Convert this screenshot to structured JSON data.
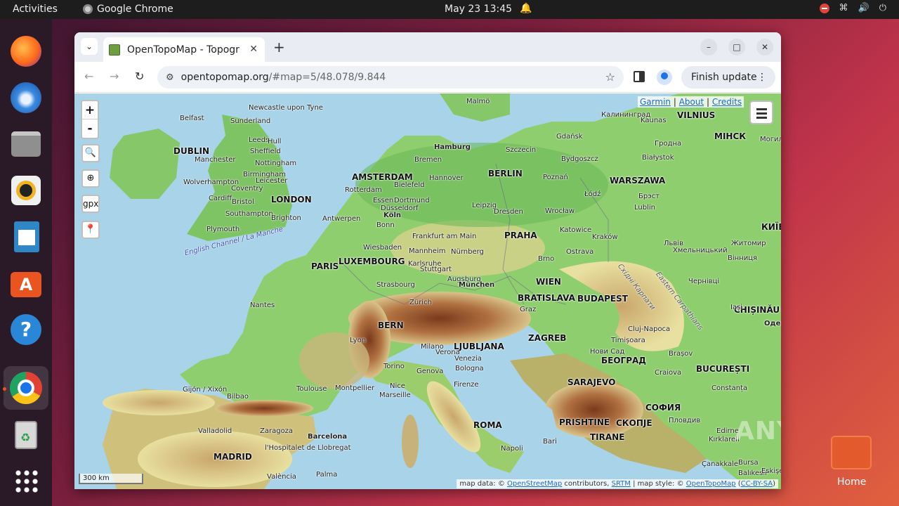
{
  "topbar": {
    "activities": "Activities",
    "app_name": "Google Chrome",
    "clock": "May 23  13:45"
  },
  "dock": {
    "items": [
      "Firefox",
      "Thunderbird",
      "Files",
      "Rhythmbox",
      "LibreOffice Writer",
      "Ubuntu Software",
      "Help",
      "Google Chrome",
      "Trash",
      "Show Applications"
    ]
  },
  "chrome": {
    "tab_title": "OpenTopoMap - Topogr",
    "address_host": "opentopomap.org",
    "address_path": "/#map=5/48.078/9.844",
    "update_label": "Finish update"
  },
  "map": {
    "zoom_in": "+",
    "zoom_out": "-",
    "gpx": "gpx",
    "attrib_top": [
      "Garmin",
      "About",
      "Credits"
    ],
    "scale": "300 km",
    "attrib_bottom_prefix": "map data: © ",
    "attrib_osm": "OpenStreetMap",
    "attrib_mid": " contributors, ",
    "attrib_srtm": "SRTM",
    "attrib_style": " | map style: © ",
    "attrib_otm": "OpenTopoMap",
    "attrib_lic": "CC-BY-SA",
    "capitals": [
      "DUBLIN",
      "LONDON",
      "AMSTERDAM",
      "BERLIN",
      "WARSZAWA",
      "VILNIUS",
      "МІНСК",
      "PARIS",
      "LUXEMBOURG",
      "PRAHA",
      "WIEN",
      "BRATISLAVA",
      "BUDAPEST",
      "BERN",
      "LJUBLJANA",
      "ZAGREB",
      "SARAJEVO",
      "БЕОГРАД",
      "BUCUREȘTI",
      "ROMA",
      "MADRID",
      "PRISHTINE",
      "СКОПЈЕ",
      "TIRANE",
      "СОФИЯ",
      "CHIȘINĂU",
      "КИЇВ"
    ],
    "cities": [
      "Newcastle upon Tyne",
      "Belfast",
      "Sunderland",
      "Leeds",
      "Hull",
      "Manchester",
      "Sheffield",
      "Nottingham",
      "Birmingham",
      "Leicester",
      "Wolverhampton",
      "Coventry",
      "Cardiff",
      "Bristol",
      "Southampton",
      "Brighton",
      "Plymouth",
      "Hamburg",
      "Bremen",
      "Rotterdam",
      "Bielefeld",
      "Hannover",
      "Essen",
      "Dortmund",
      "Düsseldorf",
      "Köln",
      "Bonn",
      "Antwerpen",
      "Frankfurt am Main",
      "Wiesbaden",
      "Mannheim",
      "Nürnberg",
      "Karlsruhe",
      "Stuttgart",
      "Strasbourg",
      "Augsburg",
      "München",
      "Zürich",
      "Lyon",
      "Milano",
      "Verona",
      "Venezia",
      "Bologna",
      "Torino",
      "Genova",
      "Firenze",
      "Nice",
      "Marseille",
      "Montpellier",
      "Toulouse",
      "Nantes",
      "Gijón / Xixón",
      "Bilbao",
      "Valladolid",
      "Zaragoza",
      "Barcelona",
      "l'Hospitalet de Llobregat",
      "València",
      "Palma",
      "Napoli",
      "Bari",
      "Szczecin",
      "Gdańsk",
      "Bydgoszcz",
      "Poznań",
      "Łódź",
      "Leipzig",
      "Dresden",
      "Wrocław",
      "Katowice",
      "Kraków",
      "Ostrava",
      "Brno",
      "Graz",
      "Malmö",
      "Калининград",
      "Kaunas",
      "Гродна",
      "Białystok",
      "Lublin",
      "Брэст",
      "Львів",
      "Хмельницький",
      "Житомир",
      "Вінниця",
      "Чернівці",
      "Iași",
      "Cluj-Napoca",
      "Timișoara",
      "Brașov",
      "Нови Сад",
      "Craiova",
      "Constanța",
      "Пловдив",
      "Edirne",
      "Kırklareli",
      "Bursa",
      "Çanakkale",
      "Balıkesir",
      "Eskişe",
      "Одес",
      "Могилёв"
    ],
    "water_label": "English Channel / La Manche",
    "range_label": "Eastern Carpathians",
    "range_label_ua": "Східні Карпати"
  },
  "watermark": "ANY.RUN",
  "desktop": {
    "home_label": "Home"
  },
  "colors": {
    "accent": "#e95420",
    "sea": "#a9d3e8",
    "lowland": "#7fc464",
    "mountain": "#a0582c"
  }
}
